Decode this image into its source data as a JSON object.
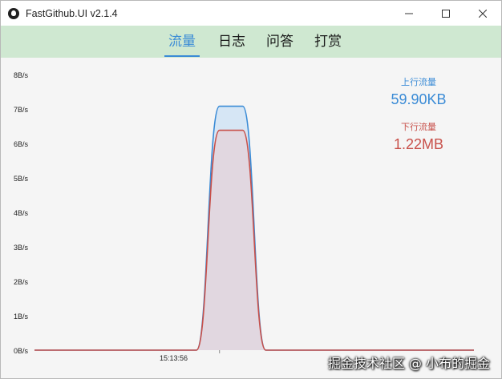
{
  "window": {
    "title": "FastGithub.UI v2.1.4"
  },
  "nav": {
    "tabs": [
      {
        "label": "流量",
        "active": true
      },
      {
        "label": "日志",
        "active": false
      },
      {
        "label": "问答",
        "active": false
      },
      {
        "label": "打赏",
        "active": false
      }
    ]
  },
  "stats": {
    "upload_label": "上行流量",
    "upload_value": "59.90KB",
    "download_label": "下行流量",
    "download_value": "1.22MB"
  },
  "chart_data": {
    "type": "area",
    "y_tick_labels": [
      "8B/s",
      "7B/s",
      "6B/s",
      "5B/s",
      "4B/s",
      "3B/s",
      "2B/s",
      "1B/s",
      "0B/s"
    ],
    "x_tick_labels": [
      "15:13:56"
    ],
    "ylim": [
      0,
      8
    ],
    "grid": false,
    "series": [
      {
        "name": "上行流量",
        "color": "#3a8bd6",
        "fill": "#d6e6f5",
        "values": [
          0,
          0,
          0,
          0,
          0,
          0,
          0,
          0,
          7.1,
          7.1,
          0,
          0,
          0,
          0,
          0,
          0,
          0,
          0,
          0,
          0
        ]
      },
      {
        "name": "下行流量",
        "color": "#c8504a",
        "fill": "#e3d3dc",
        "values": [
          0,
          0,
          0,
          0,
          0,
          0,
          0,
          0,
          6.4,
          6.4,
          0,
          0,
          0,
          0,
          0,
          0,
          0,
          0,
          0,
          0
        ]
      }
    ]
  },
  "watermark": "掘金技术社区 @ 小布的掘金",
  "colors": {
    "accent": "#3a8bd6",
    "download": "#c8504a",
    "nav_bg": "#cfe8d1"
  }
}
